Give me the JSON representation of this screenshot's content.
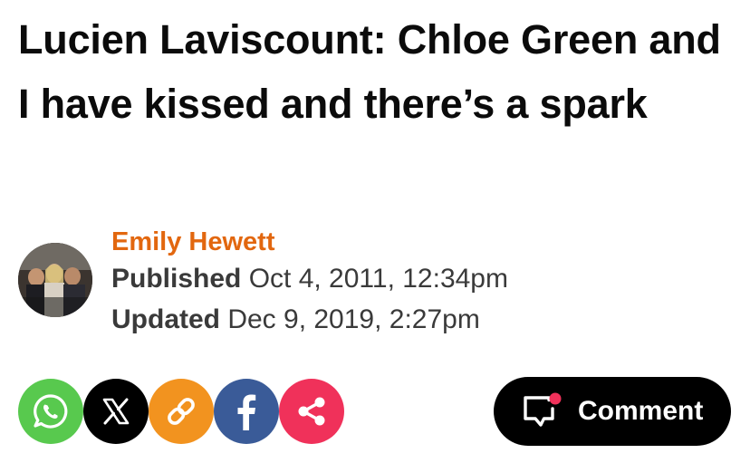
{
  "article": {
    "headline": "Lucien Laviscount: Chloe Green and I have kissed and there’s a spark"
  },
  "byline": {
    "author": "Emily Hewett",
    "published_label": "Published",
    "published_value": " Oct 4, 2011, 12:34pm",
    "updated_label": "Updated",
    "updated_value": " Dec 9, 2019, 2:27pm",
    "avatar_icon": "author-photo"
  },
  "share": {
    "buttons": [
      {
        "network": "whatsapp",
        "icon": "whatsapp-icon",
        "color": "#58c94e"
      },
      {
        "network": "x",
        "icon": "x-icon",
        "color": "#000000"
      },
      {
        "network": "link",
        "icon": "link-icon",
        "color": "#f2931f"
      },
      {
        "network": "facebook",
        "icon": "facebook-icon",
        "color": "#3a5b98"
      },
      {
        "network": "share",
        "icon": "share-icon",
        "color": "#f0315a"
      }
    ]
  },
  "comment": {
    "label": "Comment",
    "icon": "comment-bubble-icon",
    "notification_color": "#f0315a"
  },
  "colors": {
    "author": "#e2670f",
    "headline": "#0b0b0b",
    "meta": "#3a3a3a"
  }
}
